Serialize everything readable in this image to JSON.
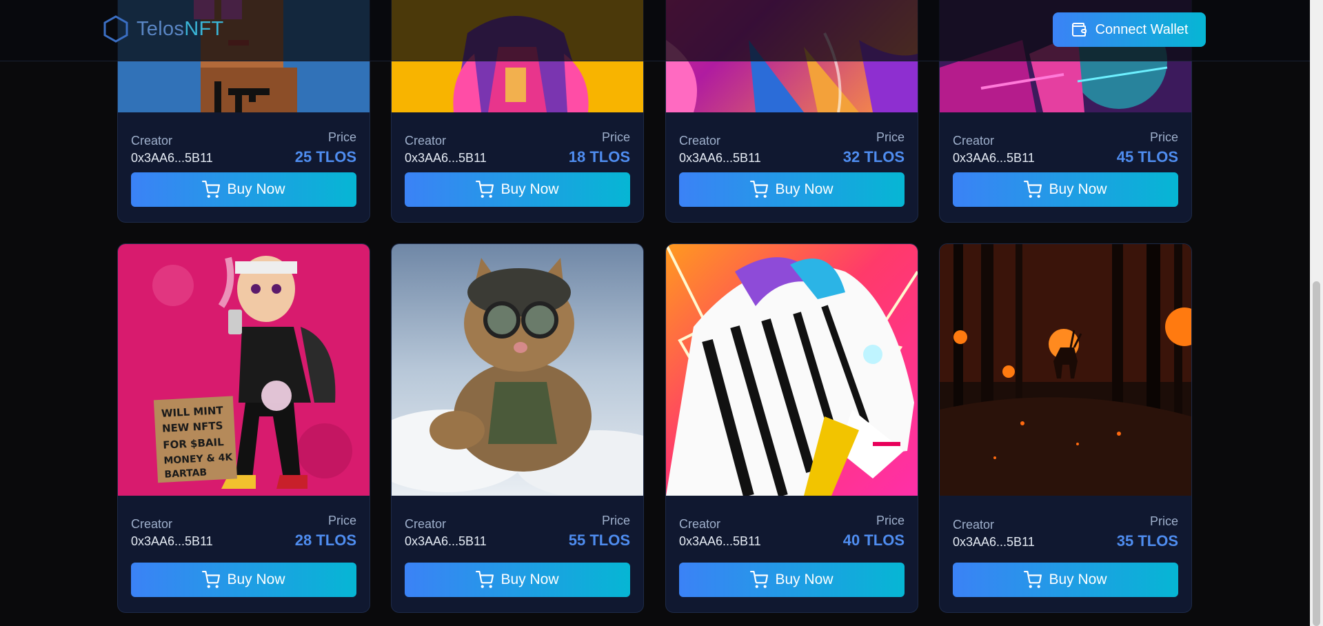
{
  "header": {
    "logo_telos": "Telos",
    "logo_nft": "NFT",
    "connect_wallet_label": "Connect Wallet"
  },
  "cards": [
    {
      "creator_label": "Creator",
      "creator": "0x3AA6...5B11",
      "price_label": "Price",
      "price": "25 TLOS",
      "buy_label": "Buy Now",
      "art": "pixel-punk-character"
    },
    {
      "creator_label": "Creator",
      "creator": "0x3AA6...5B11",
      "price_label": "Price",
      "price": "18 TLOS",
      "buy_label": "Buy Now",
      "art": "purple-jacket-character"
    },
    {
      "creator_label": "Creator",
      "creator": "0x3AA6...5B11",
      "price_label": "Price",
      "price": "32 TLOS",
      "buy_label": "Buy Now",
      "art": "neon-abstract-hair"
    },
    {
      "creator_label": "Creator",
      "creator": "0x3AA6...5B11",
      "price_label": "Price",
      "price": "45 TLOS",
      "buy_label": "Buy Now",
      "art": "neon-cyber-scene"
    },
    {
      "creator_label": "Creator",
      "creator": "0x3AA6...5B11",
      "price_label": "Price",
      "price": "28 TLOS",
      "buy_label": "Buy Now",
      "art": "cartoon-man-sign",
      "sign_text": "WILL MINT NEW NFTS FOR $BAIL MONEY & 4K BARTAB"
    },
    {
      "creator_label": "Creator",
      "creator": "0x3AA6...5B11",
      "price_label": "Price",
      "price": "55 TLOS",
      "buy_label": "Buy Now",
      "art": "skydiving-cat"
    },
    {
      "creator_label": "Creator",
      "creator": "0x3AA6...5B11",
      "price_label": "Price",
      "price": "40 TLOS",
      "buy_label": "Buy Now",
      "art": "neon-zebra"
    },
    {
      "creator_label": "Creator",
      "creator": "0x3AA6...5B11",
      "price_label": "Price",
      "price": "35 TLOS",
      "buy_label": "Buy Now",
      "art": "dark-forest-deer"
    }
  ],
  "colors": {
    "accent_start": "#3b82f6",
    "accent_end": "#06b6d4",
    "price": "#4f8df0",
    "card_bg": "#101830"
  }
}
